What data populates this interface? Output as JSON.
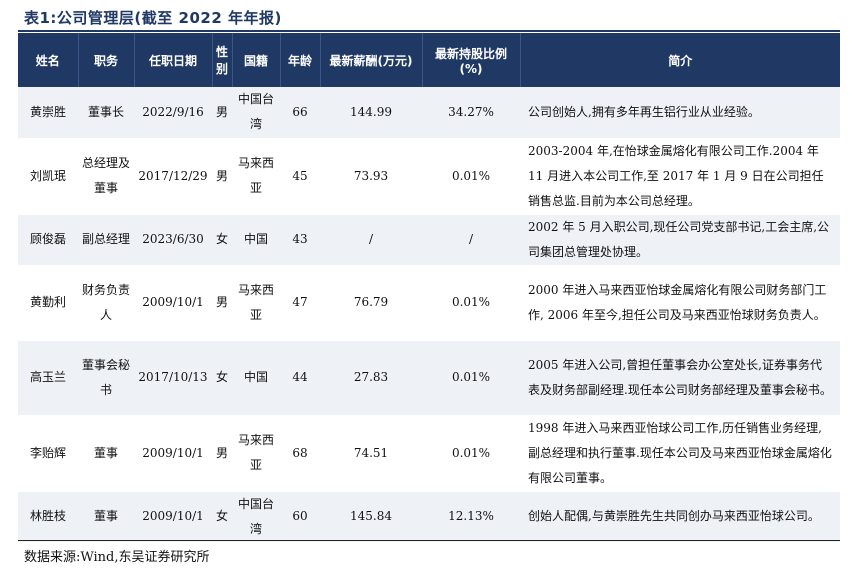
{
  "title": "表1:公司管理层(截至 2022 年年报)",
  "columns": [
    "姓名",
    "职务",
    "任职日期",
    "性别",
    "国籍",
    "年龄",
    "最新薪酬(万元)",
    "最新持股比例(%)",
    "简介"
  ],
  "rows": [
    {
      "name": "黄崇胜",
      "role": "董事长",
      "date": "2022/9/16",
      "gender": "男",
      "nationality": "中国台湾",
      "age": "66",
      "salary": "144.99",
      "share": "34.27%",
      "bio": "公司创始人,拥有多年再生铝行业从业经验。"
    },
    {
      "name": "刘凯珉",
      "role": "总经理及董事",
      "date": "2017/12/29",
      "gender": "男",
      "nationality": "马来西亚",
      "age": "45",
      "salary": "73.93",
      "share": "0.01%",
      "bio": "2003-2004 年,在怡球金属熔化有限公司工作.2004 年 11 月进入本公司工作,至 2017 年 1 月 9 日在公司担任销售总监.目前为本公司总经理。"
    },
    {
      "name": "顾俊磊",
      "role": "副总经理",
      "date": "2023/6/30",
      "gender": "女",
      "nationality": "中国",
      "age": "43",
      "salary": "/",
      "share": "/",
      "bio": "2002 年 5 月入职公司,现任公司党支部书记,工会主席,公司集团总管理处协理。"
    },
    {
      "name": "黄勤利",
      "role": "财务负责人",
      "date": "2009/10/1",
      "gender": "男",
      "nationality": "马来西亚",
      "age": "47",
      "salary": "76.79",
      "share": "0.01%",
      "bio": "2000 年进入马来西亚怡球金属熔化有限公司财务部门工作, 2006 年至今,担任公司及马来西亚怡球财务负责人。"
    },
    {
      "name": "高玉兰",
      "role": "董事会秘书",
      "date": "2017/10/13",
      "gender": "女",
      "nationality": "中国",
      "age": "44",
      "salary": "27.83",
      "share": "0.01%",
      "bio": "2005 年进入公司,曾担任董事会办公室处长,证券事务代表及财务部副经理.现任本公司财务部经理及董事会秘书。"
    },
    {
      "name": "李贻辉",
      "role": "董事",
      "date": "2009/10/1",
      "gender": "男",
      "nationality": "马来西亚",
      "age": "68",
      "salary": "74.51",
      "share": "0.01%",
      "bio": "1998 年进入马来西亚怡球公司工作,历任销售业务经理,副总经理和执行董事.现任本公司及马来西亚怡球金属熔化有限公司董事。"
    },
    {
      "name": "林胜枝",
      "role": "董事",
      "date": "2009/10/1",
      "gender": "女",
      "nationality": "中国台湾",
      "age": "60",
      "salary": "145.84",
      "share": "12.13%",
      "bio": "创始人配偶,与黄崇胜先生共同创办马来西亚怡球公司。"
    }
  ],
  "source": "数据来源:Wind,东吴证券研究所"
}
